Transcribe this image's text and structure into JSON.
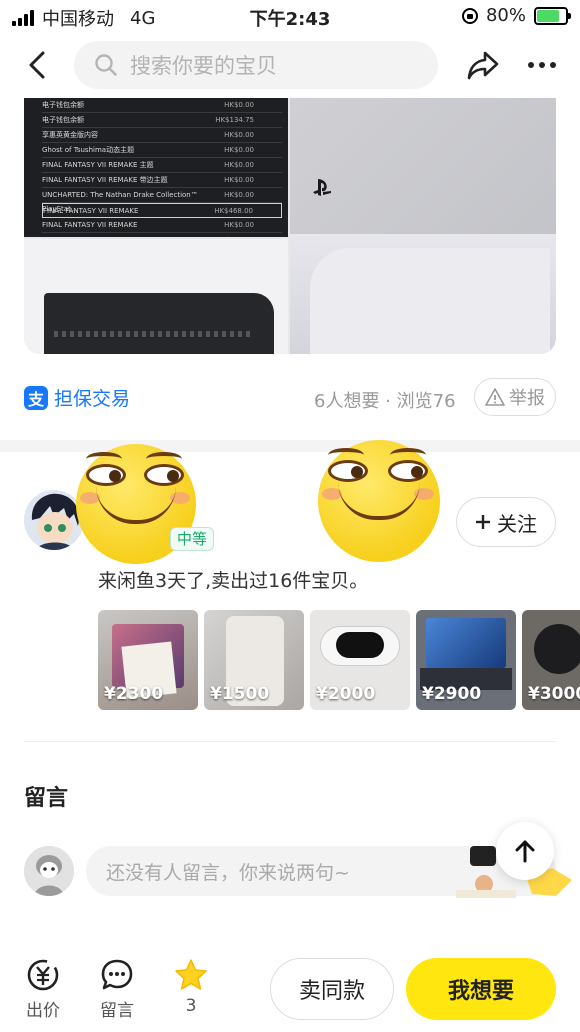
{
  "status_bar": {
    "carrier": "中国移动",
    "network": "4G",
    "time": "下午2:43",
    "battery": "80%",
    "battery_level": 0.8
  },
  "nav": {
    "search_placeholder": "搜索你要的宝贝",
    "icons": [
      "back-icon",
      "search-icon",
      "share-icon",
      "more-icon"
    ]
  },
  "photo_list": {
    "rows": [
      {
        "name": "电子钱包余额",
        "price": "HK$0.00"
      },
      {
        "name": "电子钱包余额",
        "price": "HK$134.75"
      },
      {
        "name": "享惠英黄金版内容",
        "price": "HK$0.00"
      },
      {
        "name": "Ghost of Tsushima动态主题",
        "price": "HK$0.00"
      },
      {
        "name": "FINAL FANTASY VII REMAKE 主题",
        "price": "HK$0.00"
      },
      {
        "name": "FINAL FANTASY VII REMAKE 带边主题",
        "price": "HK$0.00"
      },
      {
        "name": "UNCHARTED: The Nathan Drake Collection™ PlayStat...",
        "price": "HK$0.00"
      },
      {
        "name": "FINAL FANTASY VII REMAKE",
        "price": "HK$468.00"
      },
      {
        "name": "FINAL FANTASY VII REMAKE",
        "price": "HK$0.00"
      },
      {
        "name": "",
        "price": "HK$468.00"
      },
      {
        "name": "电子钱包余额",
        "price": ""
      }
    ]
  },
  "meta": {
    "guarantee_label": "担保交易",
    "stats": "6人想要 · 浏览76",
    "report_label": "举报"
  },
  "seller": {
    "credit_badge": "中等",
    "follow_label": "关注",
    "description": "来闲鱼3天了,卖出过16件宝贝。",
    "items": [
      {
        "price": "¥2300"
      },
      {
        "price": "¥1500"
      },
      {
        "price": "¥2000"
      },
      {
        "price": "¥2900"
      },
      {
        "price": "¥3000"
      }
    ]
  },
  "comments": {
    "title": "留言",
    "input_placeholder": "还没有人留言，你来说两句~"
  },
  "bottom_bar": {
    "offer_label": "出价",
    "message_label": "留言",
    "favorite_count": "3",
    "same_item_label": "卖同款",
    "want_label": "我想要"
  },
  "colors": {
    "accent_yellow": "#ffe60f",
    "alipay_blue": "#1677ff",
    "credit_green": "#17a86b",
    "star_yellow": "#ffd21f"
  }
}
